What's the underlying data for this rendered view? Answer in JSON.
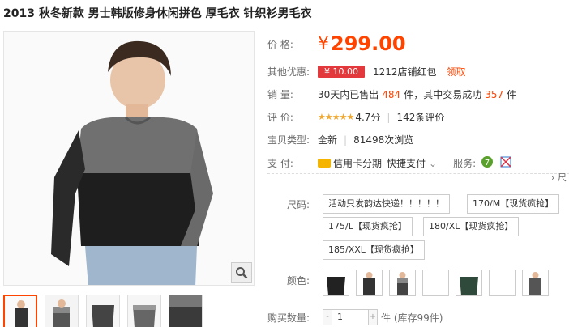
{
  "product": {
    "title": "2013 秋冬新款 男士韩版修身休闲拼色 厚毛衣 针织衫男毛衣"
  },
  "price": {
    "label": "价      格:",
    "symbol": "¥",
    "value": "299.00"
  },
  "promo": {
    "label": "其他优惠:",
    "coupon": "¥ 10.00",
    "text": "1212店铺红包",
    "claim": "领取"
  },
  "sales": {
    "label": "销      量:",
    "text1": "30天内已售出",
    "sold": "484",
    "text2": "件，其中交易成功",
    "success": "357",
    "text3": "件"
  },
  "rating": {
    "label": "评      价:",
    "stars": "★★★★★",
    "score": "4.7分",
    "sep": "|",
    "reviews": "142条评价"
  },
  "type": {
    "label": "宝贝类型:",
    "value": "全新",
    "sep": "|",
    "views": "81498次浏览"
  },
  "payment": {
    "label": "支      付:",
    "credit": "信用卡分期",
    "quick": "快捷支付",
    "dropdown": "⌄",
    "service_label": "服务:"
  },
  "more_arrow": "› 尺",
  "size": {
    "label": "尺码:",
    "options": [
      "活动只发韵达快递！！！！！",
      "170/M【现货疯抢】",
      "175/L【现货疯抢】",
      "180/XL【现货疯抢】",
      "185/XXL【现货疯抢】"
    ]
  },
  "color": {
    "label": "颜色:"
  },
  "quantity": {
    "label": "购买数量:",
    "minus": "-",
    "value": "1",
    "plus": "+",
    "stock": "件 (库存99件)"
  },
  "icons": {
    "zoom": "magnifier-icon",
    "card": "credit-card-icon",
    "service1": "seven-day-return-icon",
    "service2": "guarantee-icon"
  },
  "colors": {
    "price": "#ff4400",
    "coupon_bg": "#e4393c",
    "stars": "#f0a830"
  }
}
